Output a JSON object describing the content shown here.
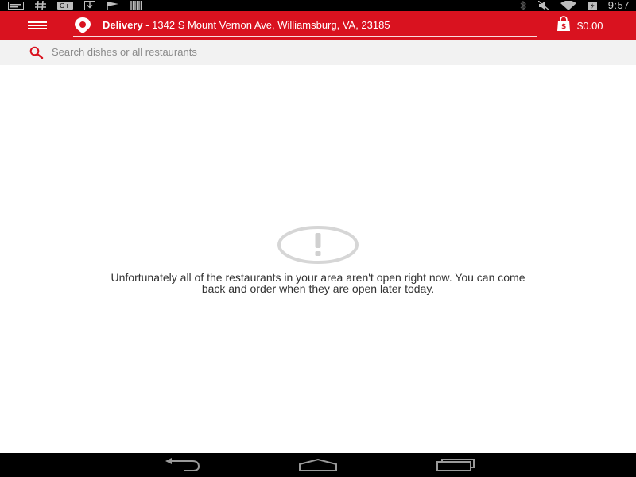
{
  "status_bar": {
    "time": "9:57",
    "left_icons": [
      "message-icon",
      "hashtag-icon",
      "google-plus-icon",
      "download-icon",
      "flag-icon",
      "barcode-icon"
    ],
    "right_icons": [
      "bluetooth-icon",
      "mute-icon",
      "wifi-icon",
      "battery-icon"
    ]
  },
  "app_bar": {
    "delivery_mode": "Delivery",
    "address": "- 1342 S Mount Vernon Ave, Williamsburg, VA, 23185",
    "cart_total": "$0.00",
    "accent_color": "#d9121f"
  },
  "search": {
    "placeholder": "Search dishes or all restaurants",
    "value": ""
  },
  "message": {
    "line1": "Unfortunately all of the restaurants in your area aren't open right now. You can come",
    "line2": "back and order when they are open later today."
  },
  "nav_bar": {
    "buttons": [
      "back-icon",
      "home-icon",
      "recents-icon"
    ]
  }
}
